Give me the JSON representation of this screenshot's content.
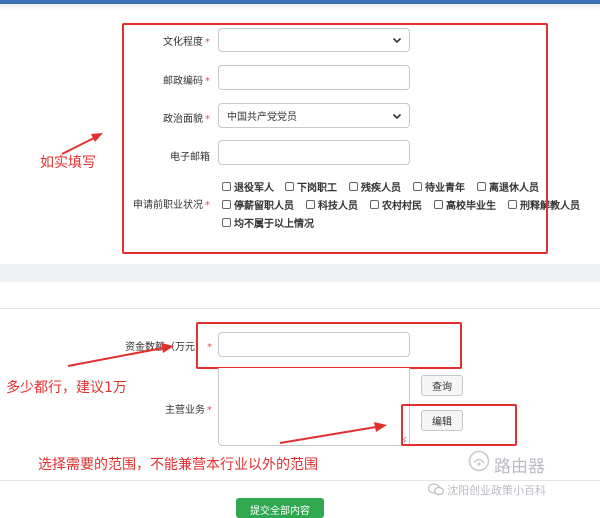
{
  "form": {
    "education_label": "文化程度",
    "postal_label": "邮政编码",
    "political_label": "政治面貌",
    "political_value": "中国共产党党员",
    "email_label": "电子邮箱",
    "status_label": "申请前职业状况",
    "required_mark": "*",
    "status_options": [
      "退役军人",
      "下岗职工",
      "残疾人员",
      "待业青年",
      "离退休人员",
      "停薪留职人员",
      "科技人员",
      "农村村民",
      "高校毕业生",
      "刑释解教人员",
      "均不属于以上情况"
    ]
  },
  "business": {
    "funds_label": "资金数额（万元）",
    "main_business_label": "主营业务",
    "query_button": "查询",
    "edit_button": "编辑",
    "submit_button": "提交全部内容"
  },
  "annotations": {
    "fill_truthfully": "如实填写",
    "amount_hint": "多少都行，建议1万",
    "scope_hint": "选择需要的范围，不能兼营本行业以外的范围"
  },
  "watermark": {
    "account": "沈阳创业政策小百科",
    "site": "路由器"
  },
  "colors": {
    "annotation_red": "#e0312f",
    "required_red": "#d9534f",
    "submit_green": "#2fa84f"
  }
}
